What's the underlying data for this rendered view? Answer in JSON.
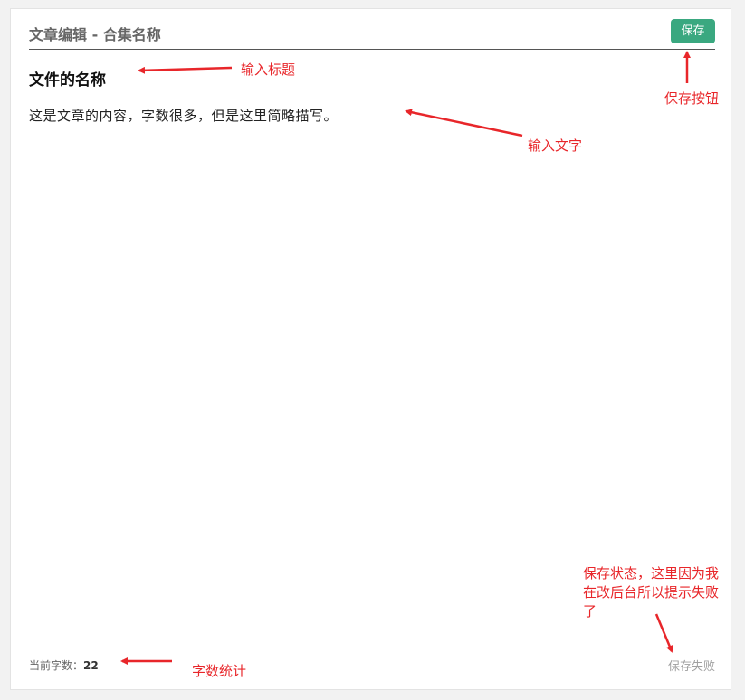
{
  "editor": {
    "header_title": "文章编辑 - 合集名称",
    "save_label": "保存",
    "doc_title": "文件的名称",
    "doc_content": "这是文章的内容，字数很多，但是这里简略描写。",
    "word_count_label": "当前字数：",
    "word_count_value": "22",
    "save_status": "保存失败"
  },
  "annotations": {
    "input_title": "输入标题",
    "save_button": "保存按钮",
    "input_text": "输入文字",
    "save_status_note": "保存状态，这里因为我在改后台所以提示失败了",
    "word_count_note": "字数统计"
  },
  "colors": {
    "save_button_bg": "#3aa880",
    "annotation_red": "#e8262a",
    "status_gray": "#a0a0a0"
  }
}
